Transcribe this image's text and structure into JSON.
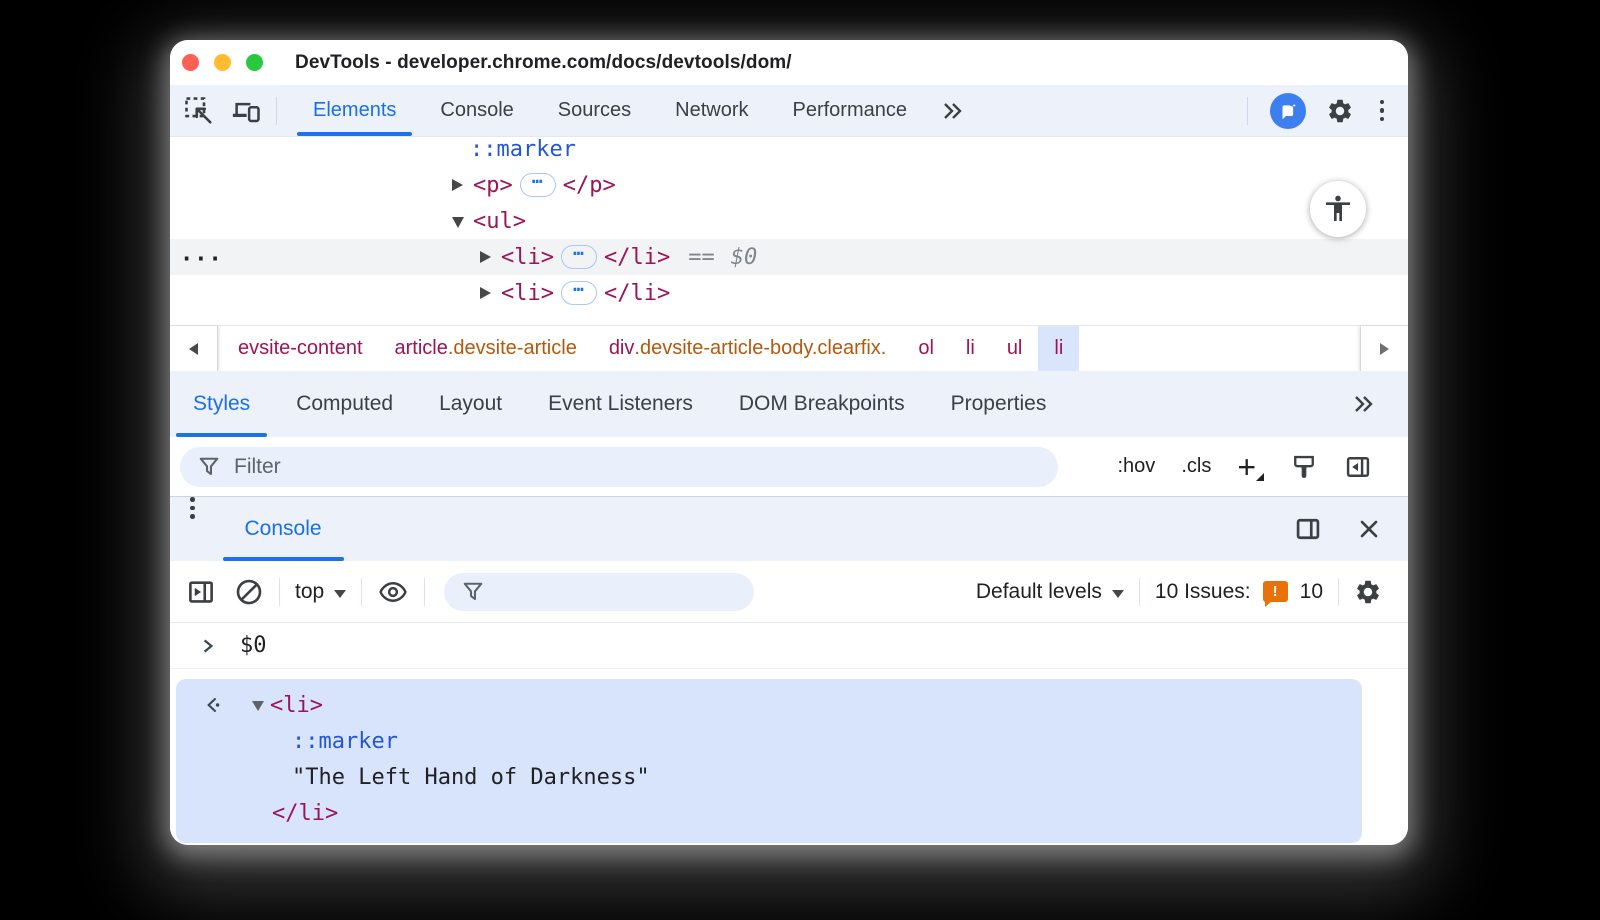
{
  "window": {
    "title": "DevTools - developer.chrome.com/docs/devtools/dom/"
  },
  "colors": {
    "accent_blue": "#1a73e8",
    "tag_maroon": "#9c1458",
    "class_orange": "#b3590e",
    "pseudo_blue": "#2456d3",
    "issues_orange": "#e8710a",
    "toolbar_bg": "#edf1fa",
    "result_bg": "#d8e4fc",
    "selected_row": "#f1f3f4",
    "selected_crumb": "#d9e5fb"
  },
  "main_tabs": {
    "items": [
      {
        "label": "Elements"
      },
      {
        "label": "Console"
      },
      {
        "label": "Sources"
      },
      {
        "label": "Network"
      },
      {
        "label": "Performance"
      }
    ],
    "more": "»"
  },
  "elements_tree": {
    "gutter_hint": "...",
    "marker_pseudo": "::marker",
    "p_open": "<p>",
    "p_close": "</p>",
    "ul_open": "<ul>",
    "li1_open": "<li>",
    "li1_close": "</li>",
    "li1_eq": "==",
    "li1_ref": "$0",
    "li2_open": "<li>",
    "li2_close": "</li>",
    "ellipsis_glyph": "⋯"
  },
  "breadcrumb": {
    "items": [
      {
        "tag": "evsite-content",
        "cls": ""
      },
      {
        "tag": "article",
        "cls": ".devsite-article"
      },
      {
        "tag": "div",
        "cls": ".devsite-article-body.clearfix."
      },
      {
        "tag": "ol",
        "cls": ""
      },
      {
        "tag": "li",
        "cls": ""
      },
      {
        "tag": "ul",
        "cls": ""
      },
      {
        "tag": "li",
        "cls": ""
      }
    ]
  },
  "styles_tabs": {
    "items": [
      {
        "label": "Styles"
      },
      {
        "label": "Computed"
      },
      {
        "label": "Layout"
      },
      {
        "label": "Event Listeners"
      },
      {
        "label": "DOM Breakpoints"
      },
      {
        "label": "Properties"
      }
    ],
    "more": "»"
  },
  "styles_toolbar": {
    "filter_placeholder": "Filter",
    "hov": ":hov",
    "cls": ".cls",
    "plus": "+"
  },
  "drawer": {
    "tab": "Console"
  },
  "console_toolbar": {
    "context": "top",
    "levels": "Default levels",
    "issues_label": "10 Issues:",
    "issues_badge_glyph": "!",
    "issues_count": "10"
  },
  "console": {
    "echo": "$0",
    "li_open": "<li>",
    "marker": "::marker",
    "text": "\"The Left Hand of Darkness\"",
    "li_close": "</li>"
  }
}
